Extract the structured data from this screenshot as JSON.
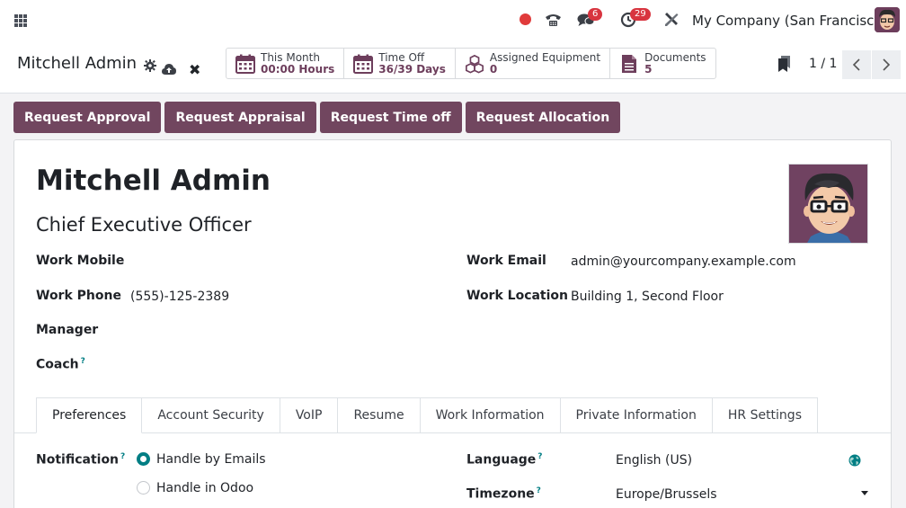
{
  "navbar": {
    "company": "My Company (San Francisco)",
    "messages_badge": "6",
    "activities_badge": "29",
    "icons": [
      "apps-icon",
      "record-icon",
      "phone-icon",
      "chat-icon",
      "clock-icon",
      "tools-icon",
      "user-avatar"
    ]
  },
  "control_panel": {
    "breadcrumb": "Mitchell Admin",
    "pager": "1 / 1",
    "smart_buttons": [
      {
        "label": "This Month",
        "value": "00:00 Hours",
        "icon": "calendar-icon"
      },
      {
        "label": "Time Off",
        "value": "36/39 Days",
        "icon": "calendar-icon"
      },
      {
        "label": "Assigned Equipment",
        "value": "0",
        "icon": "cubes-icon"
      },
      {
        "label": "Documents",
        "value": "5",
        "icon": "document-icon"
      }
    ]
  },
  "actions": [
    "Request Approval",
    "Request Appraisal",
    "Request Time off",
    "Request Allocation"
  ],
  "employee": {
    "name": "Mitchell Admin",
    "job_title": "Chief Executive Officer",
    "fields_left": [
      {
        "label": "Work Mobile",
        "value": ""
      },
      {
        "label": "Work Phone",
        "value": "(555)-125-2389"
      },
      {
        "label": "Manager",
        "value": ""
      },
      {
        "label": "Coach",
        "value": "",
        "help": "?"
      }
    ],
    "fields_right": [
      {
        "label": "Work Email",
        "value": "admin@yourcompany.example.com"
      },
      {
        "label": "Work Location",
        "value": "Building 1, Second Floor"
      }
    ]
  },
  "tabs": [
    "Preferences",
    "Account Security",
    "VoIP",
    "Resume",
    "Work Information",
    "Private Information",
    "HR Settings"
  ],
  "preferences": {
    "notification_label": "Notification",
    "help": "?",
    "options": [
      "Handle by Emails",
      "Handle in Odoo"
    ],
    "selected_option": "Handle by Emails",
    "language_label": "Language",
    "language_value": "English (US)",
    "timezone_label": "Timezone",
    "timezone_value": "Europe/Brussels"
  },
  "colors": {
    "primary": "#71465f",
    "accent": "#017e84",
    "badge": "#d8343f",
    "record": "#e03b3b"
  }
}
